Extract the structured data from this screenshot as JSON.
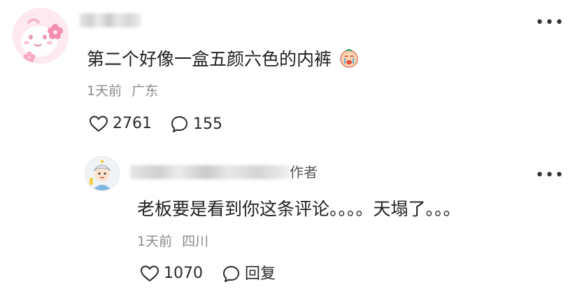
{
  "comment": {
    "text": "第二个好像一盒五颜六色的内裤",
    "time": "1天前",
    "location": "广东",
    "likes": "2761",
    "replies": "155",
    "more": "•••"
  },
  "reply": {
    "author_badge": "作者",
    "text": "老板要是看到你这条评论。。。。天塌了。。。",
    "time": "1天前",
    "location": "四川",
    "likes": "1070",
    "reply_label": "回复",
    "more": "•••"
  },
  "icons": {
    "heart": "heart-icon",
    "comment": "comment-bubble-icon",
    "more": "more-horizontal-icon",
    "emoji": "crying-face-emoji"
  },
  "colors": {
    "text": "#1f1f1f",
    "meta": "#8a8a8a",
    "avatar_pink": "#fde9ef"
  }
}
